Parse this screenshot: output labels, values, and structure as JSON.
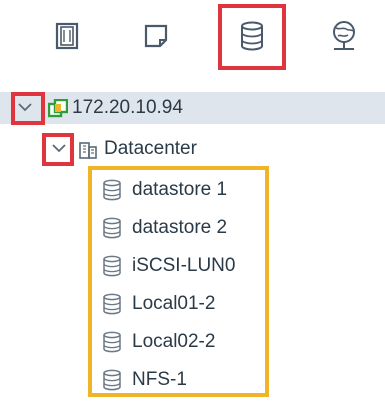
{
  "toolbar": {
    "tabs": [
      {
        "name": "hosts-and-clusters",
        "icon": "hosts-clusters-icon"
      },
      {
        "name": "vms-and-templates",
        "icon": "vms-templates-icon"
      },
      {
        "name": "storage",
        "icon": "storage-icon",
        "selected": true
      },
      {
        "name": "networking",
        "icon": "networking-icon"
      }
    ],
    "highlight_color": "#e0353f"
  },
  "tree": {
    "host": {
      "label": "172.20.10.94",
      "icon": "vcenter-icon",
      "expanded": true
    },
    "datacenter": {
      "label": "Datacenter",
      "icon": "datacenter-icon",
      "expanded": true
    },
    "datastores": [
      {
        "label": "datastore 1",
        "icon": "datastore-icon"
      },
      {
        "label": "datastore 2",
        "icon": "datastore-icon"
      },
      {
        "label": "iSCSI-LUN0",
        "icon": "datastore-icon"
      },
      {
        "label": "Local01-2",
        "icon": "datastore-icon"
      },
      {
        "label": "Local02-2",
        "icon": "datastore-icon"
      },
      {
        "label": "NFS-1",
        "icon": "datastore-icon"
      }
    ],
    "datastore_highlight_color": "#f0b429",
    "selected_row_color": "#dfe5ec"
  }
}
